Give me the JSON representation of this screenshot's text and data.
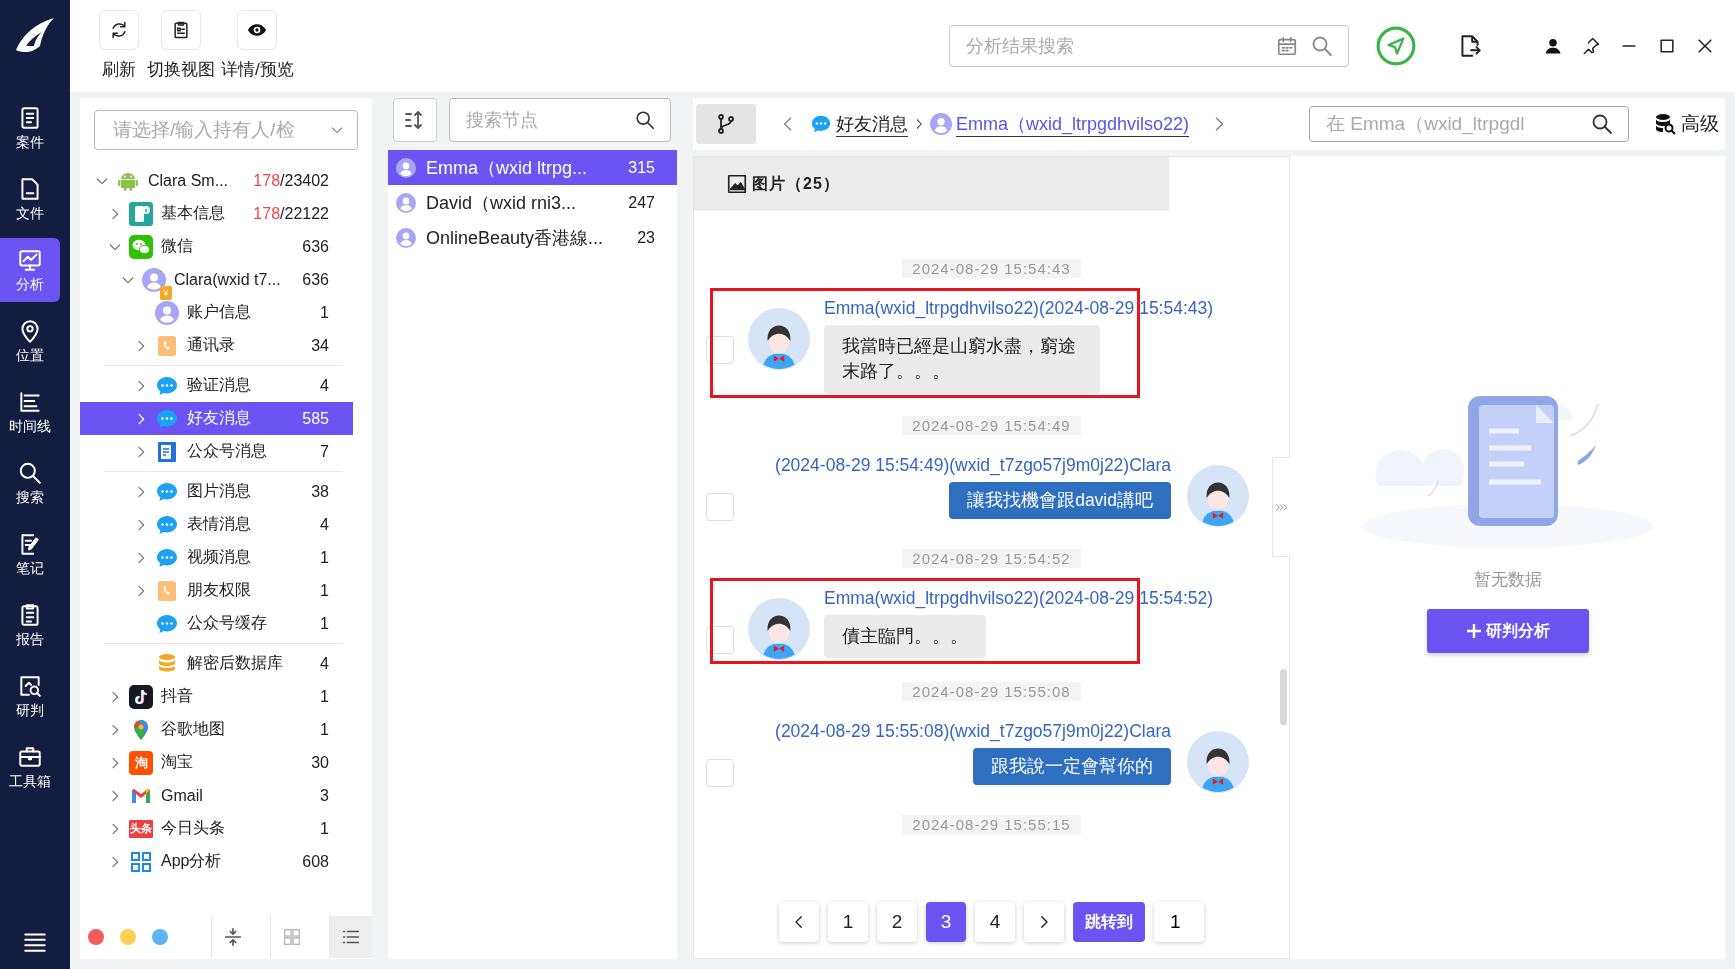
{
  "nav": {
    "items": [
      {
        "label": "案件",
        "kind": "case",
        "selected": false
      },
      {
        "label": "文件",
        "kind": "file",
        "selected": false
      },
      {
        "label": "分析",
        "kind": "analysis",
        "selected": true
      },
      {
        "label": "位置",
        "kind": "location",
        "selected": false
      },
      {
        "label": "时间线",
        "kind": "timeline",
        "selected": false
      },
      {
        "label": "搜索",
        "kind": "search",
        "selected": false
      },
      {
        "label": "笔记",
        "kind": "note",
        "selected": false
      },
      {
        "label": "报告",
        "kind": "report",
        "selected": false
      },
      {
        "label": "研判",
        "kind": "judge",
        "selected": false
      },
      {
        "label": "工具箱",
        "kind": "toolbox",
        "selected": false
      }
    ]
  },
  "toolbar": {
    "buttons": [
      {
        "label": "刷新",
        "kind": "refresh"
      },
      {
        "label": "切换视图",
        "kind": "view"
      },
      {
        "label": "详情/预览",
        "kind": "preview"
      }
    ],
    "search": {
      "placeholder": "分析结果搜索"
    }
  },
  "tree": {
    "holder_select": {
      "placeholder": "请选择/输入持有人/检"
    },
    "items": [
      {
        "label": "Clara Sm...",
        "kind": "android",
        "flagged": "178",
        "count": "/23402",
        "expanded": true,
        "selected": false,
        "children": [
          {
            "label": "基本信息",
            "kind": "app-info",
            "flagged": "178",
            "count": "/22122",
            "expanded": false,
            "selected": false
          },
          {
            "label": "微信",
            "kind": "wechat",
            "count": "636",
            "expanded": true,
            "selected": false,
            "children": [
              {
                "label": "Clara(wxid t7...",
                "kind": "user-badge",
                "icon_text": "¥",
                "count": "636",
                "expanded": true,
                "selected": false,
                "children": [
                  {
                    "label": "账户信息",
                    "kind": "user",
                    "count": "1",
                    "selected": false
                  },
                  {
                    "label": "通讯录",
                    "kind": "contacts",
                    "count": "34",
                    "expanded": false,
                    "selected": false
                  },
                  {
                    "label": "验证消息",
                    "kind": "chat",
                    "count": "4",
                    "expanded": false,
                    "selected": false,
                    "divider_above": true
                  },
                  {
                    "label": "好友消息",
                    "kind": "chat",
                    "count": "585",
                    "expanded": false,
                    "selected": true
                  },
                  {
                    "label": "公众号消息",
                    "kind": "official",
                    "count": "7",
                    "expanded": false,
                    "selected": false
                  },
                  {
                    "label": "图片消息",
                    "kind": "chat",
                    "count": "38",
                    "expanded": false,
                    "selected": false,
                    "divider_above": true
                  },
                  {
                    "label": "表情消息",
                    "kind": "chat",
                    "count": "4",
                    "expanded": false,
                    "selected": false
                  },
                  {
                    "label": "视频消息",
                    "kind": "chat",
                    "count": "1",
                    "expanded": false,
                    "selected": false
                  },
                  {
                    "label": "朋友权限",
                    "kind": "contacts",
                    "count": "1",
                    "expanded": false,
                    "selected": false
                  },
                  {
                    "label": "公众号缓存",
                    "kind": "chat",
                    "count": "1",
                    "selected": false
                  },
                  {
                    "label": "解密后数据库",
                    "kind": "database",
                    "count": "4",
                    "selected": false,
                    "divider_above": true
                  }
                ]
              }
            ]
          },
          {
            "label": "抖音",
            "kind": "douyin",
            "count": "1",
            "expanded": false,
            "selected": false
          },
          {
            "label": "谷歌地图",
            "kind": "maps",
            "count": "1",
            "expanded": false,
            "selected": false
          },
          {
            "label": "淘宝",
            "kind": "taobao",
            "icon_text": "淘",
            "count": "30",
            "expanded": false,
            "selected": false
          },
          {
            "label": "Gmail",
            "kind": "gmail",
            "count": "3",
            "expanded": false,
            "selected": false
          },
          {
            "label": "今日头条",
            "kind": "toutiao",
            "icon_text": "头条",
            "count": "1",
            "expanded": false,
            "selected": false
          },
          {
            "label": "App分析",
            "kind": "apps",
            "count": "608",
            "expanded": false,
            "selected": false
          }
        ]
      }
    ],
    "color_dots": [
      {
        "color": "#f25c5c"
      },
      {
        "color": "#fdd04f"
      },
      {
        "color": "#5ab4f5"
      }
    ],
    "view_modes": [
      {
        "kind": "collapse",
        "selected": false
      },
      {
        "kind": "grid",
        "selected": false
      },
      {
        "kind": "list",
        "selected": true
      }
    ]
  },
  "contacts": {
    "search": {
      "placeholder": "搜索节点"
    },
    "items": [
      {
        "name": "Emma（wxid ltrpg...",
        "count": "315",
        "selected": true
      },
      {
        "name": "David（wxid rni3...",
        "count": "247",
        "selected": false
      },
      {
        "name": "OnlineBeauty香港線...",
        "count": "23",
        "selected": false
      }
    ]
  },
  "chat": {
    "breadcrumb": [
      {
        "label": "好友消息",
        "kind": "chat"
      },
      {
        "label": "Emma（wxid_ltrpgdhvilso22)",
        "kind": "user"
      }
    ],
    "search": {
      "placeholder": "在 Emma（wxid_ltrpgdl"
    },
    "advanced": "高级",
    "tabs": [
      {
        "label": "图片（25）",
        "selected": true
      }
    ],
    "feed": [
      {
        "kind": "time",
        "text": "2024-08-29 15:54:43"
      },
      {
        "kind": "incoming",
        "header": "Emma(wxid_ltrpgdhvilso22)(2024-08-29 15:54:43)",
        "text": "我當時已經是山窮水盡，窮途末路了。。。",
        "checked": false,
        "highlighted": true
      },
      {
        "kind": "time",
        "text": "2024-08-29 15:54:49"
      },
      {
        "kind": "outgoing",
        "header": "(2024-08-29 15:54:49)(wxid_t7zgo57j9m0j22)Clara",
        "text": "讓我找機會跟david講吧",
        "checked": false,
        "highlighted": false
      },
      {
        "kind": "time",
        "text": "2024-08-29 15:54:52"
      },
      {
        "kind": "incoming",
        "header": "Emma(wxid_ltrpgdhvilso22)(2024-08-29 15:54:52)",
        "text": "債主臨門。。。",
        "checked": false,
        "highlighted": true
      },
      {
        "kind": "time",
        "text": "2024-08-29 15:55:08"
      },
      {
        "kind": "outgoing",
        "header": "(2024-08-29 15:55:08)(wxid_t7zgo57j9m0j22)Clara",
        "text": "跟我說一定會幫你的",
        "checked": false,
        "highlighted": false
      },
      {
        "kind": "time",
        "text": "2024-08-29 15:55:15"
      }
    ],
    "pages": [
      {
        "label": "1",
        "selected": false
      },
      {
        "label": "2",
        "selected": false
      },
      {
        "label": "3",
        "selected": true
      },
      {
        "label": "4",
        "selected": false
      }
    ],
    "jump": "跳转到",
    "jump_value": "1"
  },
  "analysis": {
    "empty": "暂无数据",
    "button": "研判分析"
  }
}
